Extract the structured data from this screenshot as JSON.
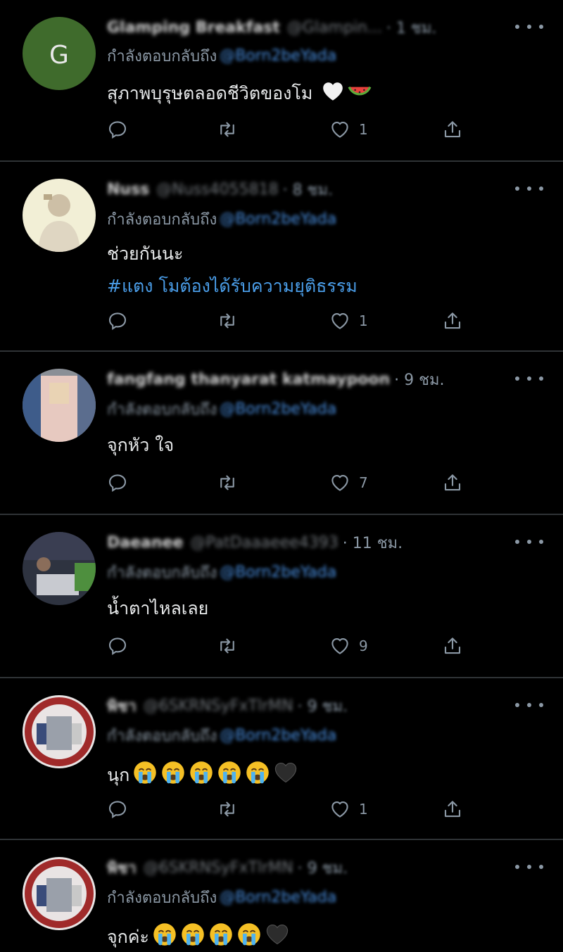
{
  "colors": {
    "background": "#000000",
    "mention": "#4a90e2",
    "hashtag": "#4a9de8",
    "muted": "#8b98a5"
  },
  "tweets": [
    {
      "name": "Glamping Breakfast",
      "handle": "@Glampin...",
      "time": "· 1 ชม.",
      "replying_label": "กำลังตอบกลับถึง",
      "mention": "@Born2beYada",
      "text": "สุภาพบุรุษตลอดชีวิตของโม",
      "hashtag": "",
      "emojis": [
        "white-heart-icon",
        "watermelon-icon"
      ],
      "likes": "1",
      "avatar_letter": "G"
    },
    {
      "name": "Nuss",
      "handle": "@Nuss4055818",
      "time": "· 8 ชม.",
      "replying_label": "กำลังตอบกลับถึง",
      "mention": "@Born2beYada",
      "text": "ช่วยกันนะ",
      "hashtag": "#แตง โมต้องได้รับความยุติธรรม",
      "emojis": [],
      "likes": "1"
    },
    {
      "name": "fangfang thanyarat katmaypoon",
      "handle": "",
      "time": "· 9 ชม.",
      "replying_label": "กำลังตอบกลับถึง",
      "mention": "@Born2beYada",
      "text": "จุกหัว ใจ",
      "hashtag": "",
      "emojis": [],
      "likes": "7"
    },
    {
      "name": "Daeanee",
      "handle": "@PatDaaaeee4393",
      "time": "· 11 ชม.",
      "replying_label": "กำลังตอบกลับถึง",
      "mention": "@Born2beYada",
      "text": "น้ำตาไหลเลย",
      "hashtag": "",
      "emojis": [],
      "likes": "9"
    },
    {
      "name": "พิชา",
      "handle": "@6SKRNSyFxTlrMN",
      "time": "· 9 ชม.",
      "replying_label": "กำลังตอบกลับถึง",
      "mention": "@Born2beYada",
      "text": "นุก",
      "hashtag": "",
      "emojis": [
        "crying-face-icon",
        "crying-face-icon",
        "crying-face-icon",
        "crying-face-icon",
        "crying-face-icon",
        "black-heart-icon"
      ],
      "likes": "1"
    },
    {
      "name": "พิชา",
      "handle": "@6SKRNSyFxTlrMN",
      "time": "· 9 ชม.",
      "replying_label": "กำลังตอบกลับถึง",
      "mention": "@Born2beYada",
      "text": "จุกค่ะ",
      "hashtag": "",
      "emojis": [
        "crying-face-icon",
        "crying-face-icon",
        "crying-face-icon",
        "crying-face-icon",
        "black-heart-icon"
      ],
      "likes": ""
    }
  ]
}
